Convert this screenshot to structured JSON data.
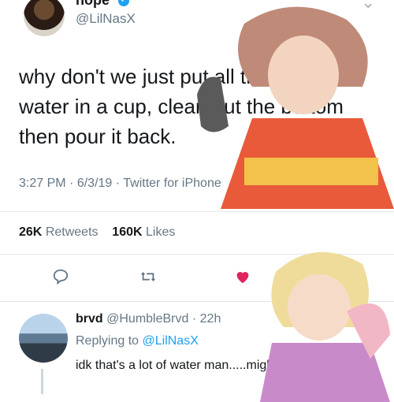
{
  "tweet": {
    "display_name": "nope",
    "handle": "@LilNasX",
    "text": "why don't we just put all the ocean water in a cup, clean out the bottom then pour it back.",
    "time": "3:27 PM",
    "date": "6/3/19",
    "source": "Twitter for iPhone",
    "retweets_count": "26K",
    "retweets_label": "Retweets",
    "likes_count": "160K",
    "likes_label": "Likes"
  },
  "reply": {
    "display_name": "brvd",
    "handle": "@HumbleBrvd",
    "age": "22h",
    "replying_prefix": "Replying to",
    "replying_to": "@LilNasX",
    "text": "idk that's a lot of water man.....might need two cups"
  },
  "icons": {
    "verified": "verified-badge-icon",
    "reply": "reply-icon",
    "retweet": "retweet-icon",
    "like": "heart-icon",
    "share": "share-icon",
    "more": "chevron-down-icon"
  },
  "colors": {
    "accent": "#1da1f2",
    "like": "#e0245e",
    "muted": "#657786"
  }
}
